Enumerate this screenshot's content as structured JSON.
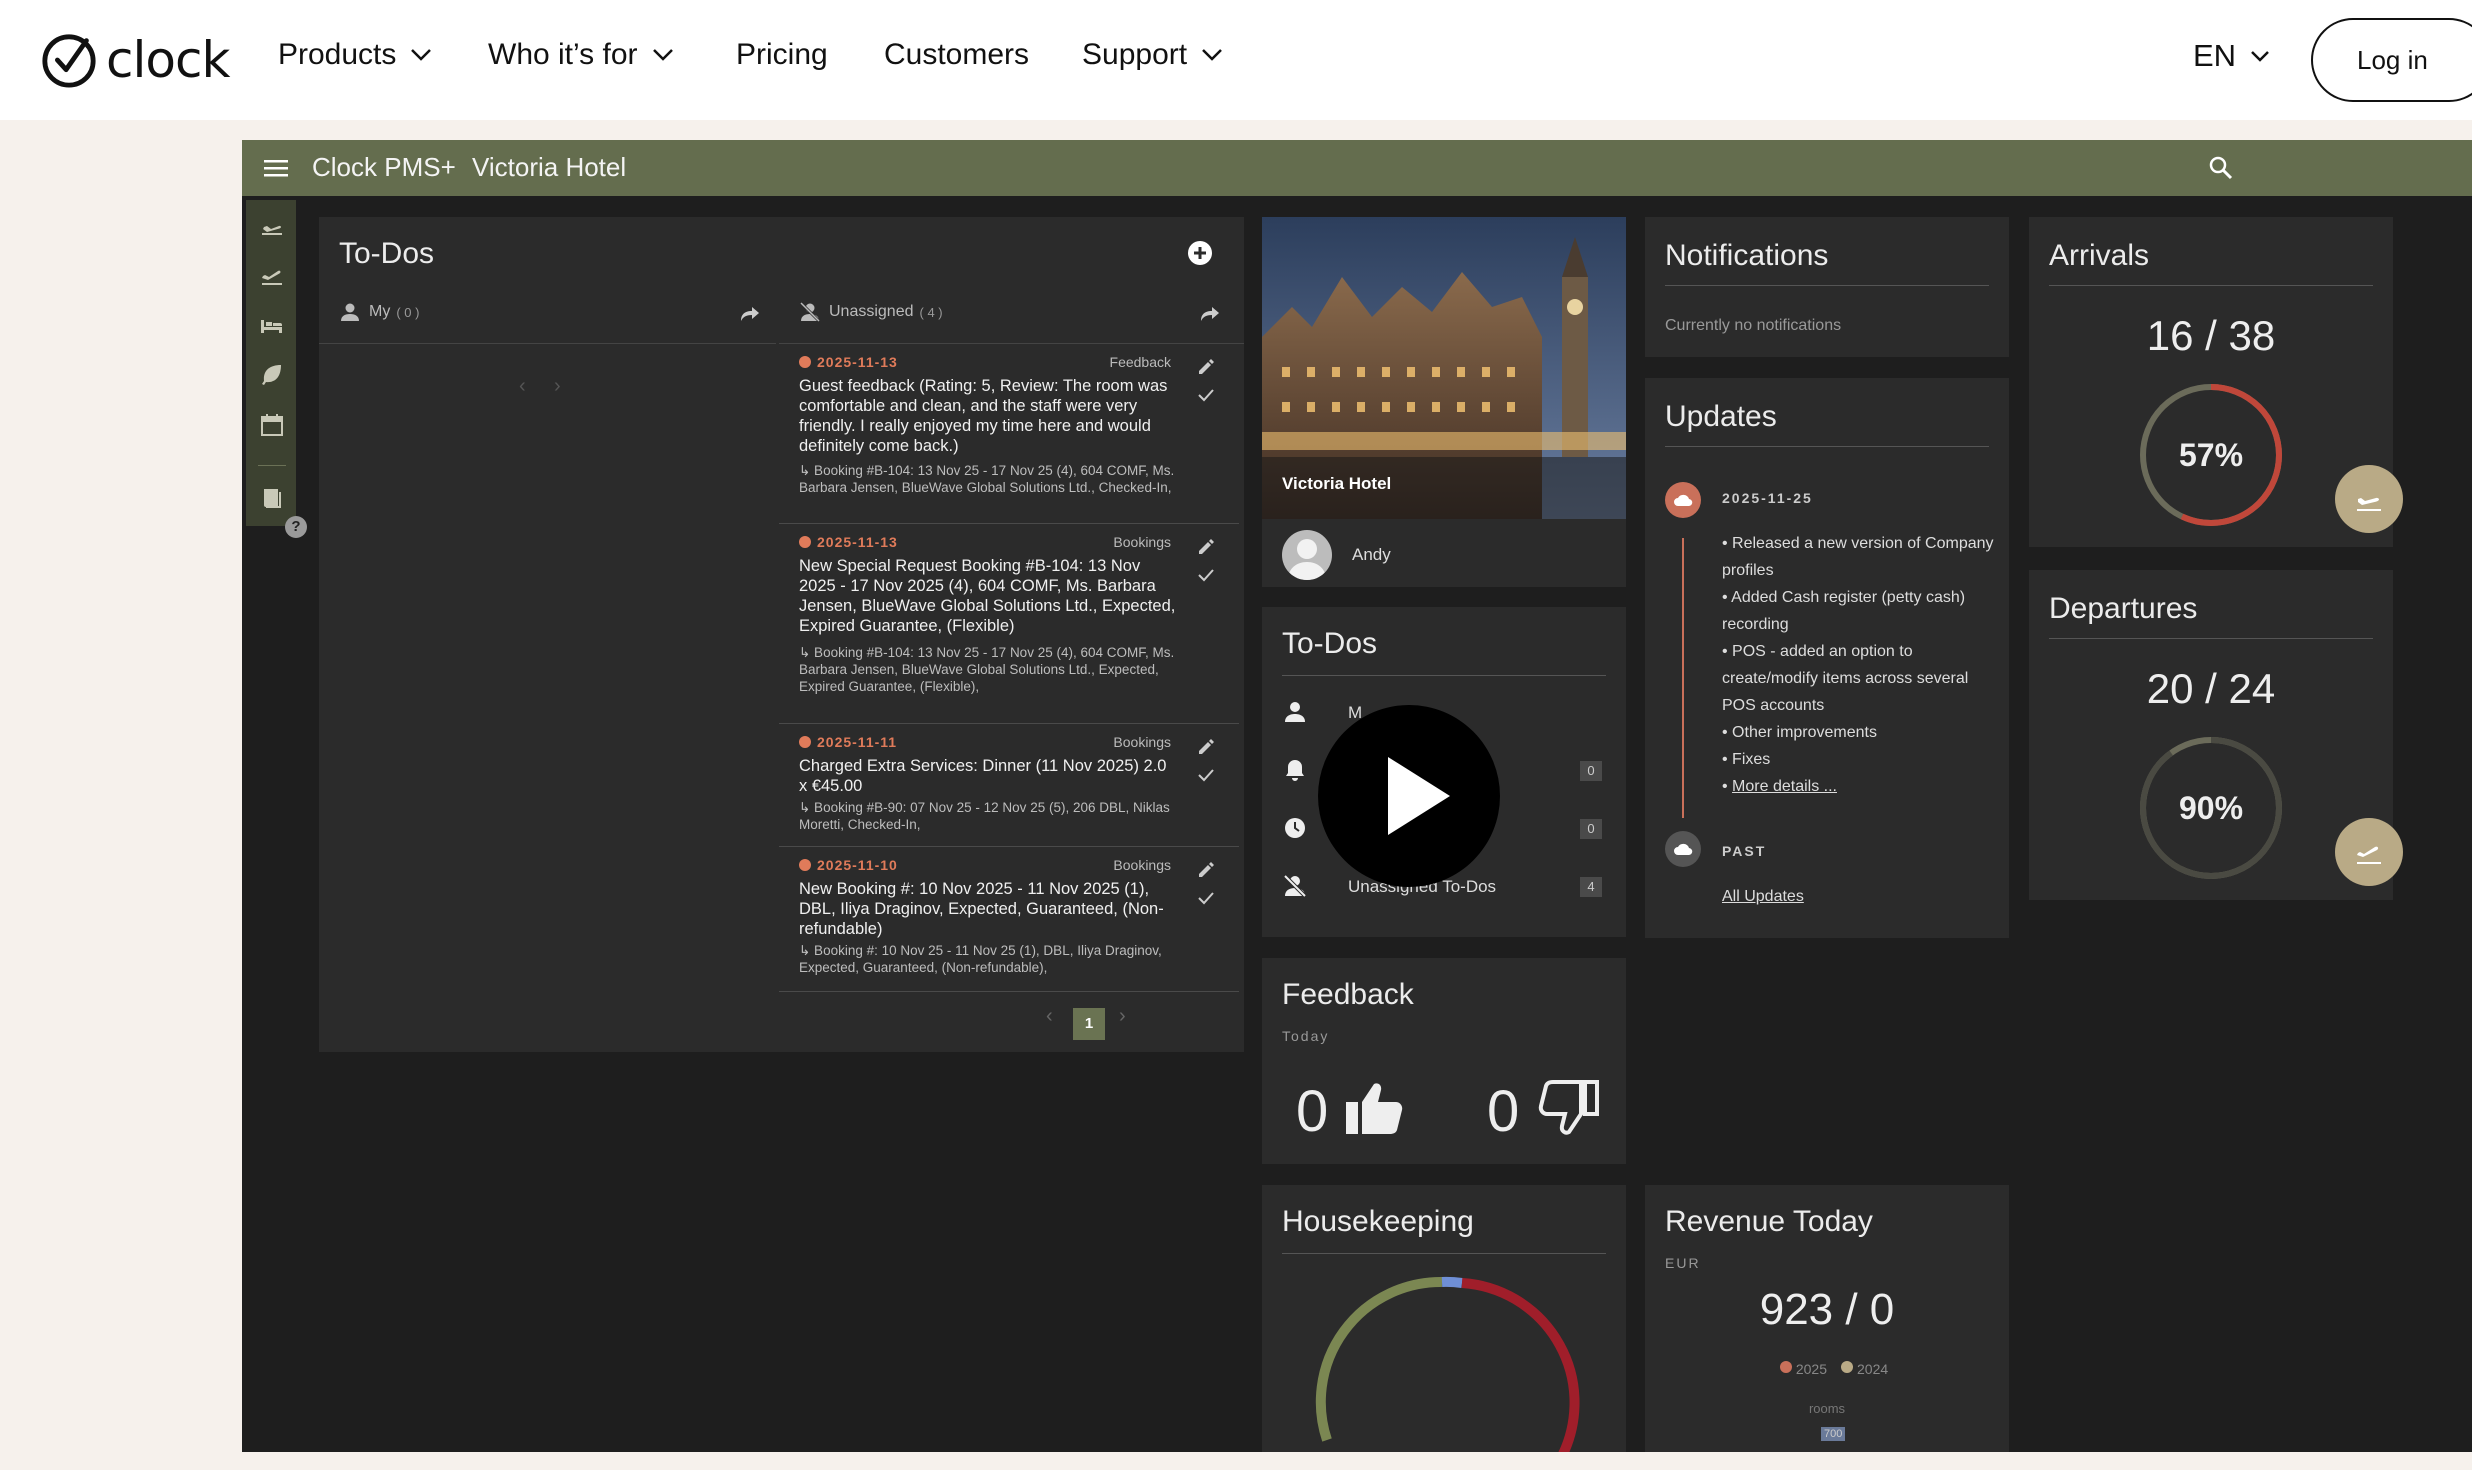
{
  "site": {
    "logo_text": "clock",
    "nav": [
      "Products",
      "Who it’s for",
      "Pricing",
      "Customers",
      "Support"
    ],
    "language": "EN",
    "login_label": "Log in"
  },
  "app": {
    "title": "Clock PMS+",
    "hotel": "Victoria Hotel",
    "todos_main": {
      "title": "To-Dos",
      "my_label": "My",
      "my_count": "( 0 )",
      "unassigned_label": "Unassigned",
      "unassigned_count": "( 4 )",
      "page": "1",
      "items": [
        {
          "date": "2025-11-13",
          "category": "Feedback",
          "text": "Guest feedback (Rating: 5, Review: The room was comfortable and clean, and the staff were very friendly. I really enjoyed my time here and would definitely come back.)",
          "sub": "↳ Booking #B-104: 13 Nov 25 - 17 Nov 25 (4), 604 COMF, Ms. Barbara Jensen, BlueWave Global Solutions Ltd., Checked-In,"
        },
        {
          "date": "2025-11-13",
          "category": "Bookings",
          "text": "New Special Request Booking #B-104: 13 Nov 2025 - 17 Nov 2025 (4), 604 COMF, Ms. Barbara Jensen, BlueWave Global Solutions Ltd., Expected, Expired Guarantee, (Flexible)",
          "sub": "↳ Booking #B-104: 13 Nov 25 - 17 Nov 25 (4), 604 COMF, Ms. Barbara Jensen, BlueWave Global Solutions Ltd., Expected, Expired Guarantee, (Flexible),"
        },
        {
          "date": "2025-11-11",
          "category": "Bookings",
          "text": "Charged Extra Services: Dinner (11 Nov 2025) 2.0 x €45.00",
          "sub": "↳ Booking #B-90: 07 Nov 25 - 12 Nov 25 (5), 206 DBL, Niklas Moretti, Checked-In,"
        },
        {
          "date": "2025-11-10",
          "category": "Bookings",
          "text": "New Booking #: 10 Nov 2025 - 11 Nov 2025 (1), DBL, Iliya Draginov, Expected, Guaranteed, (Non-refundable)",
          "sub": "↳ Booking #: 10 Nov 25 - 11 Nov 25 (1), DBL, Iliya Draginov, Expected, Guaranteed, (Non-refundable),"
        }
      ]
    },
    "hotel_card": {
      "name": "Victoria Hotel",
      "user": "Andy"
    },
    "todos_small": {
      "title": "To-Dos",
      "my_label": "M",
      "count_bell": "0",
      "count_clock": "0",
      "unassigned_label": "Unassigned To-Dos",
      "count_unassigned": "4"
    },
    "feedback": {
      "title": "Feedback",
      "period": "Today",
      "positive": "0",
      "negative": "0"
    },
    "housekeeping": {
      "title": "Housekeeping"
    },
    "notifications": {
      "title": "Notifications",
      "empty": "Currently no notifications"
    },
    "updates": {
      "title": "Updates",
      "date": "2025-11-25",
      "items": [
        "Released a new version of Company profiles",
        "Added Cash register (petty cash) recording",
        "POS - added an option to create/modify items across several POS accounts",
        "Other improvements",
        "Fixes"
      ],
      "more": "More details ...",
      "past": "PAST",
      "all": "All Updates"
    },
    "revenue": {
      "title": "Revenue Today",
      "currency": "EUR",
      "value": "923 / 0",
      "legend_a": "2025",
      "legend_b": "2024",
      "unit": "rooms",
      "tick": "700"
    },
    "arrivals": {
      "title": "Arrivals",
      "value": "16 / 38",
      "pct": "57%",
      "fraction": 0.57
    },
    "departures": {
      "title": "Departures",
      "value": "20 / 24",
      "pct": "90%",
      "fraction": 0.9
    }
  },
  "colors": {
    "app_bar": "#646d4e",
    "accent_orange": "#e07b5a",
    "gauge_arc": "#c0473a",
    "gauge_track": "#6b6b5a",
    "fab": "#b9aa86"
  }
}
